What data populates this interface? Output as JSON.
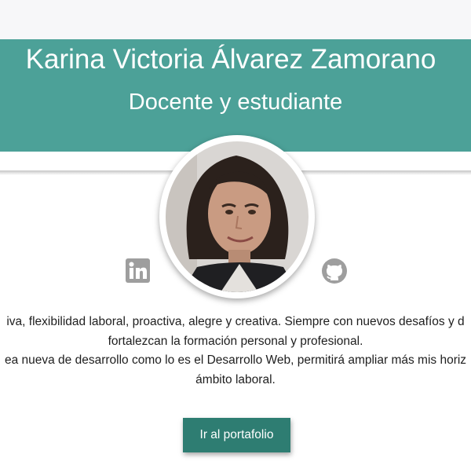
{
  "profile": {
    "name": "Karina Victoria Álvarez Zamorano",
    "role": "Docente y estudiante",
    "avatar_alt": "profile-photo"
  },
  "social": {
    "linkedin_icon": "linkedin-icon",
    "github_icon": "github-icon"
  },
  "bio": {
    "line1": "iva, flexibilidad laboral, proactiva, alegre y creativa. Siempre con nuevos desafíos y d",
    "line2": "fortalezcan la formación personal y profesional.",
    "line3": "ea nueva de desarrollo como lo es el Desarrollo Web, permitirá ampliar más mis horiz",
    "line4": "ámbito laboral."
  },
  "actions": {
    "portfolio_label": "Ir al portafolio"
  },
  "colors": {
    "header": "#4ca198",
    "button": "#2e7d72",
    "icon": "#9e9e9e"
  }
}
